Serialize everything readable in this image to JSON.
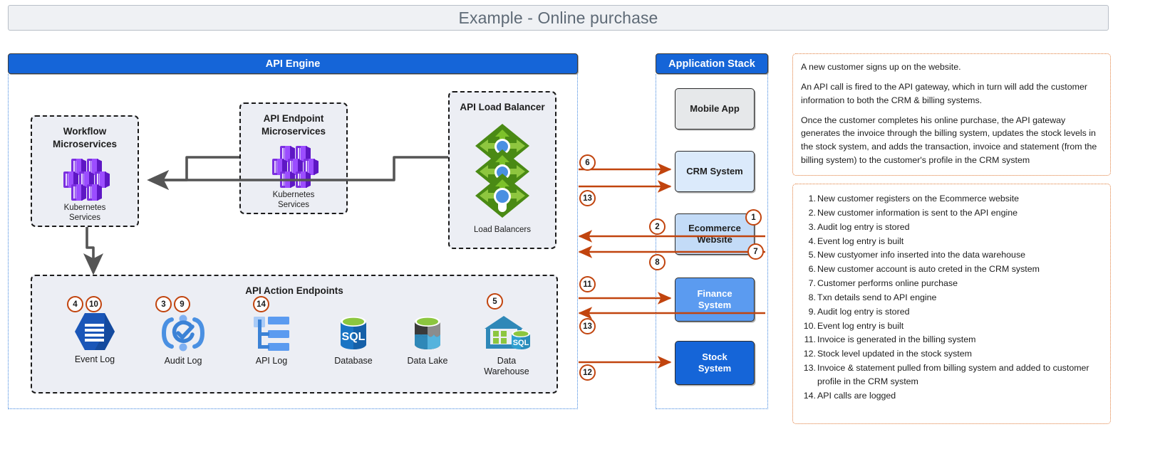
{
  "title": "Example - Online purchase",
  "api_engine": {
    "header": "API Engine",
    "workflow": {
      "title_l1": "Workflow",
      "title_l2": "Microservices",
      "caption_l1": "Kubernetes",
      "caption_l2": "Services"
    },
    "endpoint": {
      "title_l1": "API Endpoint",
      "title_l2": "Microservices",
      "caption_l1": "Kubernetes",
      "caption_l2": "Services"
    },
    "load_balancer": {
      "title": "API Load Balancer",
      "caption": "Load Balancers"
    },
    "action_endpoints": {
      "title": "API Action Endpoints",
      "items": [
        {
          "label": "Event Log",
          "badges": [
            "4",
            "10"
          ]
        },
        {
          "label": "Audit Log",
          "badges": [
            "3",
            "9"
          ]
        },
        {
          "label": "API Log",
          "badges": [
            "14"
          ]
        },
        {
          "label": "Database",
          "badges": []
        },
        {
          "label": "Data Lake",
          "badges": []
        },
        {
          "label_l1": "Data",
          "label_l2": "Warehouse",
          "label": "Data Warehouse",
          "badges": [
            "5"
          ]
        }
      ]
    }
  },
  "app_stack": {
    "header": "Application Stack",
    "systems": [
      {
        "name": "Mobile App",
        "line1": "Mobile App",
        "line2": "",
        "fill": "#e6e8ea",
        "text": "#1f1f1f"
      },
      {
        "name": "CRM System",
        "line1": "CRM System",
        "line2": "",
        "fill": "#dbeafb",
        "text": "#1f1f1f"
      },
      {
        "name": "Ecommerce Website",
        "line1": "Ecommerce",
        "line2": "Website",
        "fill": "#c3dbf7",
        "text": "#1f1f1f",
        "badges": [
          "1",
          "7"
        ]
      },
      {
        "name": "Finance System",
        "line1": "Finance",
        "line2": "System",
        "fill": "#5b9bf0",
        "text": "#ffffff"
      },
      {
        "name": "Stock System",
        "line1": "Stock",
        "line2": "System",
        "fill": "#1565d8",
        "text": "#ffffff"
      }
    ]
  },
  "flow_badges": [
    "6",
    "13",
    "2",
    "8",
    "11",
    "13",
    "12"
  ],
  "description": [
    "A new customer signs up on the website.",
    "An API call is fired to the API gateway, which in turn will add the customer information to both the CRM & billing systems.",
    "Once the customer completes his online purchase, the API gateway generates the invoice through the billing system, updates the stock levels in the stock system, and adds the transaction, invoice and statement (from the billing system) to the customer's profile in the CRM system"
  ],
  "steps": [
    "New customer registers on the Ecommerce website",
    "New customer information is sent to the API engine",
    "Audit log entry is stored",
    "Event log entry is built",
    "New custyomer info inserted into the data warehouse",
    "New customer account is auto creted in the CRM system",
    "Customer performs online purchase",
    "Txn details send to API engine",
    "Audit log entry is stored",
    "Event log entry is built",
    "Invoice is generated in the billing system",
    "Stock level updated in the stock system",
    "Invoice & statement pulled from billing system and added to customer profile in the CRM system",
    "API calls are logged"
  ],
  "colors": {
    "accent_blue": "#1565d8",
    "arrow_orange": "#c1440e",
    "arrow_gray": "#555555",
    "panel_dotted": "#e07b39",
    "k8s_purple": "#7b2fe0"
  }
}
